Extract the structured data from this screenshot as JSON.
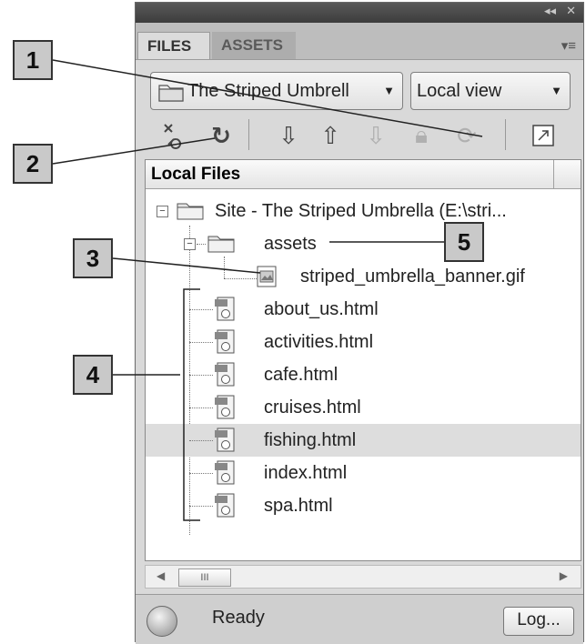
{
  "panel": {
    "tabs": [
      {
        "label": "FILES"
      },
      {
        "label": "ASSETS"
      }
    ],
    "titlebar_controls": {
      "collapse": "◂◂",
      "close": "✕"
    },
    "menu_icon": "≡"
  },
  "toolbar": {
    "site_select": {
      "value": "The Striped Umbrell"
    },
    "view_select": {
      "value": "Local view"
    },
    "buttons": [
      "connect-icon",
      "refresh-icon",
      "get-icon",
      "put-icon",
      "check-out-icon",
      "check-in-icon",
      "synchronize-icon",
      "expand-icon"
    ]
  },
  "filelist": {
    "column_header": "Local Files",
    "site_row": "Site  - The Striped Umbrella  (E:\\stri...",
    "assets_folder": "assets",
    "asset_files": [
      "striped_umbrella_banner.gif"
    ],
    "files": [
      "about_us.html",
      "activities.html",
      "cafe.html",
      "cruises.html",
      "fishing.html",
      "index.html",
      "spa.html"
    ],
    "selected_file": "fishing.html"
  },
  "scrollbar": {
    "thumb_label": "III"
  },
  "status": {
    "text": "Ready",
    "log_button": "Log..."
  },
  "callouts": [
    "1",
    "2",
    "3",
    "4",
    "5"
  ]
}
